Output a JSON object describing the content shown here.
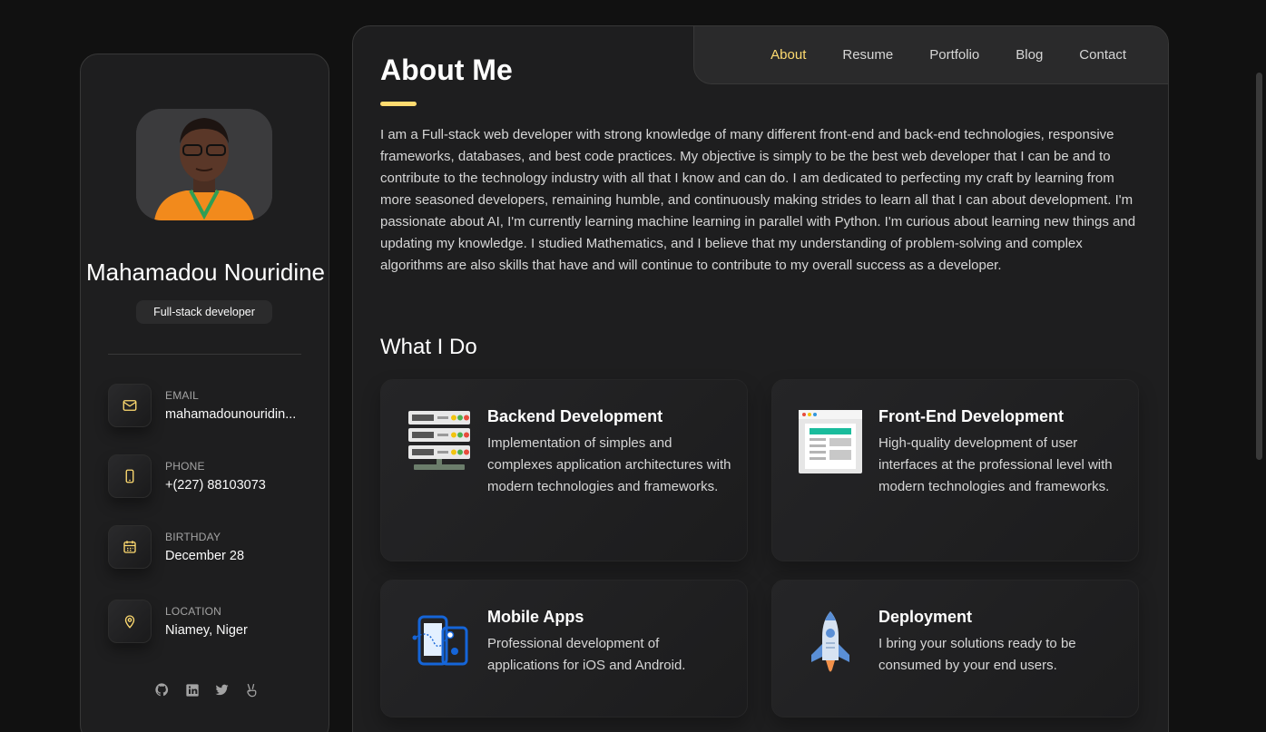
{
  "profile": {
    "name": "Mahamadou Nouridine",
    "title": "Full-stack developer",
    "contacts": [
      {
        "label": "Email",
        "value": "mahamadounouridin...",
        "icon": "mail-icon"
      },
      {
        "label": "Phone",
        "value": "+(227) 88103073",
        "icon": "phone-icon"
      },
      {
        "label": "Birthday",
        "value": "December 28",
        "icon": "calendar-icon"
      },
      {
        "label": "Location",
        "value": "Niamey, Niger",
        "icon": "location-pin-icon"
      }
    ],
    "socials": [
      "github-icon",
      "linkedin-icon",
      "twitter-icon",
      "peace-hand-icon"
    ]
  },
  "nav": {
    "items": [
      "About",
      "Resume",
      "Portfolio",
      "Blog",
      "Contact"
    ],
    "active": "About"
  },
  "about": {
    "title": "About Me",
    "text": "I am a Full-stack web developer with strong knowledge of many different front-end and back-end technologies, responsive frameworks, databases, and best code practices. My objective is simply to be the best web developer that I can be and to contribute to the technology industry with all that I know and can do. I am dedicated to perfecting my craft by learning from more seasoned developers, remaining humble, and continuously making strides to learn all that I can about development. I'm passionate about AI, I'm currently learning machine learning in parallel with Python. I'm curious about learning new things and updating my knowledge. I studied Mathematics, and I believe that my understanding of problem-solving and complex algorithms are also skills that have and will continue to contribute to my overall success as a developer."
  },
  "services": {
    "title": "What I Do",
    "items": [
      {
        "title": "Backend Development",
        "desc": "Implementation of simples and complexes application architectures with modern technologies and frameworks.",
        "icon": "server-rack-icon"
      },
      {
        "title": "Front-End Development",
        "desc": "High-quality development of user interfaces at the professional level with modern technologies and frameworks.",
        "icon": "browser-layout-icon"
      },
      {
        "title": "Mobile Apps",
        "desc": "Professional development of applications for iOS and Android.",
        "icon": "mobile-devices-icon"
      },
      {
        "title": "Deployment",
        "desc": "I bring your solutions ready to be consumed by your end users.",
        "icon": "rocket-icon"
      }
    ]
  },
  "colors": {
    "accent": "#ffdb70",
    "background": "#111111",
    "card": "#1e1e1f"
  }
}
